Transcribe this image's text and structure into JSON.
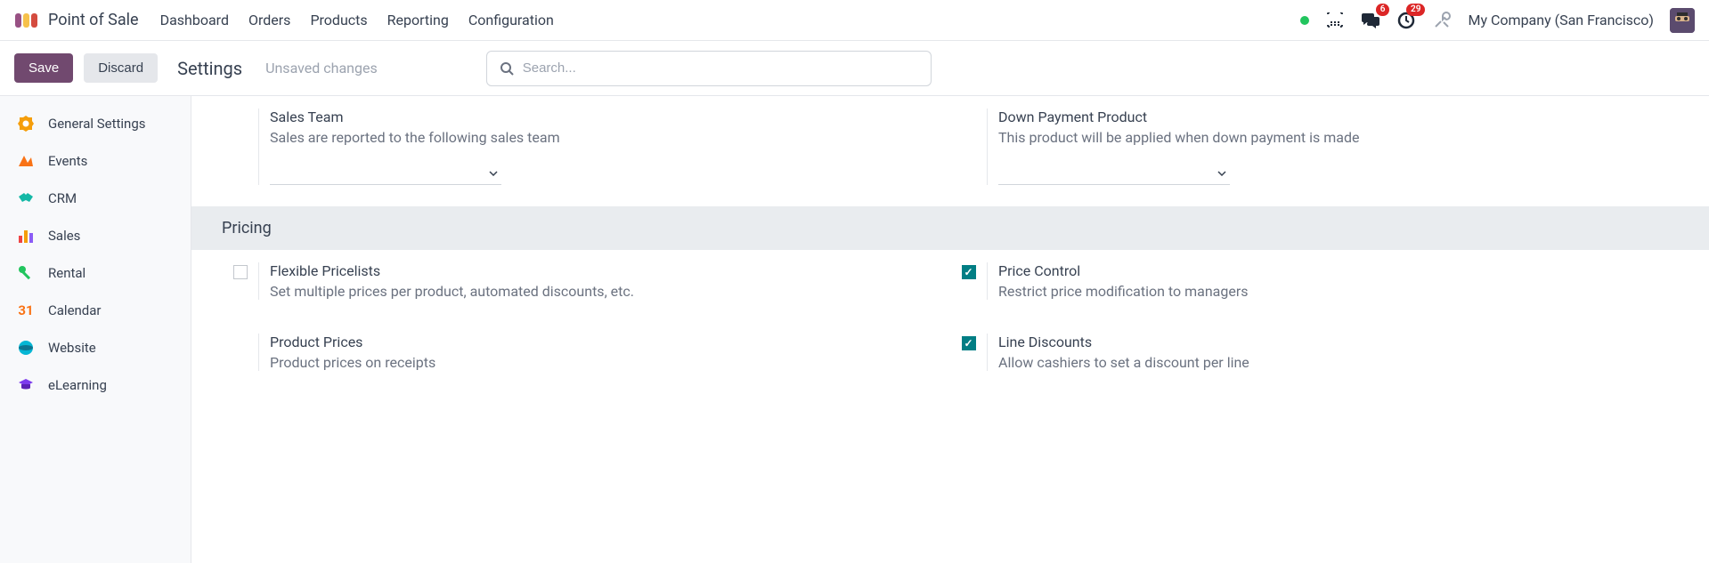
{
  "app": {
    "title": "Point of Sale"
  },
  "nav": {
    "items": [
      "Dashboard",
      "Orders",
      "Products",
      "Reporting",
      "Configuration"
    ],
    "badge_chat": "6",
    "badge_activity": "29",
    "company": "My Company (San Francisco)"
  },
  "actionbar": {
    "save": "Save",
    "discard": "Discard",
    "breadcrumb": "Settings",
    "unsaved": "Unsaved changes",
    "search_placeholder": "Search..."
  },
  "sidebar": {
    "items": [
      {
        "label": "General Settings"
      },
      {
        "label": "Events"
      },
      {
        "label": "CRM"
      },
      {
        "label": "Sales"
      },
      {
        "label": "Rental"
      },
      {
        "label": "Calendar"
      },
      {
        "label": "Website"
      },
      {
        "label": "eLearning"
      }
    ]
  },
  "settings": {
    "sales_team": {
      "title": "Sales Team",
      "desc": "Sales are reported to the following sales team"
    },
    "down_payment": {
      "title": "Down Payment Product",
      "desc": "This product will be applied when down payment is made"
    },
    "section_pricing": "Pricing",
    "flex_pricelists": {
      "title": "Flexible Pricelists",
      "desc": "Set multiple prices per product, automated discounts, etc."
    },
    "price_control": {
      "title": "Price Control",
      "desc": "Restrict price modification to managers"
    },
    "product_prices": {
      "title": "Product Prices",
      "desc": "Product prices on receipts"
    },
    "line_discounts": {
      "title": "Line Discounts",
      "desc": "Allow cashiers to set a discount per line"
    }
  }
}
